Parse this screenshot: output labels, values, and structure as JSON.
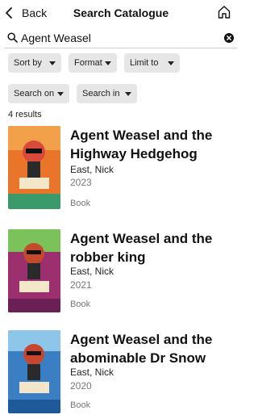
{
  "header": {
    "back_label": "Back",
    "title": "Search Catalogue",
    "back_icon": "chevron-left-icon",
    "home_icon": "home-icon"
  },
  "search": {
    "value": "Agent Weasel",
    "icon": "search-icon",
    "clear_icon": "clear-icon"
  },
  "filters": {
    "sort_by": "Sort by",
    "format": "Format",
    "limit_to": "Limit to",
    "search_on": "Search on",
    "search_in": "Search in"
  },
  "results_count": "4 results",
  "results": [
    {
      "title": "Agent Weasel and the Highway Hedgehog",
      "author": "East, Nick",
      "year": "2023",
      "format": "Book",
      "cover_color": "#e8752a"
    },
    {
      "title": "Agent Weasel and the robber king",
      "author": "East, Nick",
      "year": "2021",
      "format": "Book",
      "cover_color": "#9c2f6d"
    },
    {
      "title": "Agent Weasel and the abominable Dr Snow",
      "author": "East, Nick",
      "year": "2020",
      "format": "Book",
      "cover_color": "#3a7fc4"
    }
  ]
}
